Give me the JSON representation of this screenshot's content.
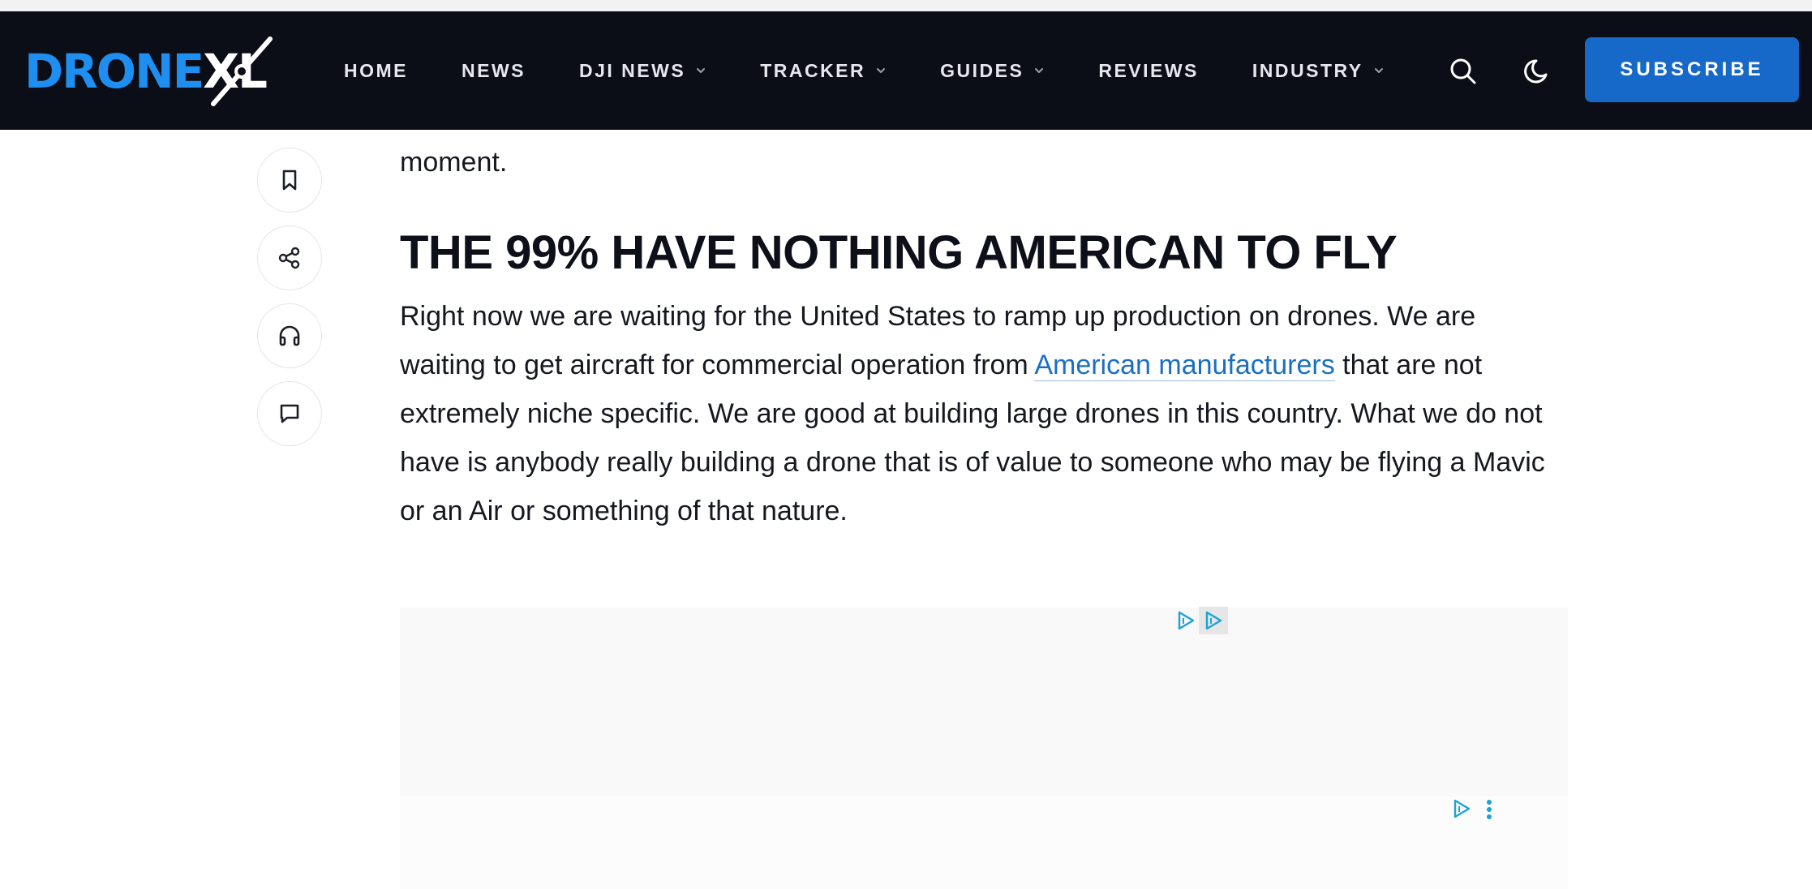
{
  "header": {
    "logo": {
      "part1": "DRONE",
      "part2": "XL"
    },
    "nav": [
      {
        "label": "HOME",
        "has_dropdown": false
      },
      {
        "label": "NEWS",
        "has_dropdown": false
      },
      {
        "label": "DJI NEWS",
        "has_dropdown": true
      },
      {
        "label": "TRACKER",
        "has_dropdown": true
      },
      {
        "label": "GUIDES",
        "has_dropdown": true
      },
      {
        "label": "REVIEWS",
        "has_dropdown": false
      },
      {
        "label": "INDUSTRY",
        "has_dropdown": true
      }
    ],
    "icons": {
      "search": "search-icon",
      "theme": "moon-icon"
    },
    "subscribe_label": "SUBSCRIBE"
  },
  "action_rail": {
    "icons": [
      "bookmark-icon",
      "share-icon",
      "headphones-icon",
      "comment-icon"
    ]
  },
  "article": {
    "fragment": "moment.",
    "heading": "THE 99% HAVE NOTHING AMERICAN TO FLY",
    "paragraph": {
      "before_link": "Right now we are waiting for the United States to ramp up production on drones. We are waiting to get aircraft for commercial operation from ",
      "link_text": "American manufacturers",
      "after_link": " that are not extremely niche specific. We are good at building large drones in this country. What we do not have is anybody really building a drone that is of value to someone who may be flying a Mavic or an Air or something of that nature."
    }
  },
  "colors": {
    "header_bg": "#0b0e16",
    "brand_blue": "#1e8ff0",
    "subscribe_bg": "#1669c9",
    "link": "#1a6fc4",
    "adchoices": "#1aa3d9"
  }
}
